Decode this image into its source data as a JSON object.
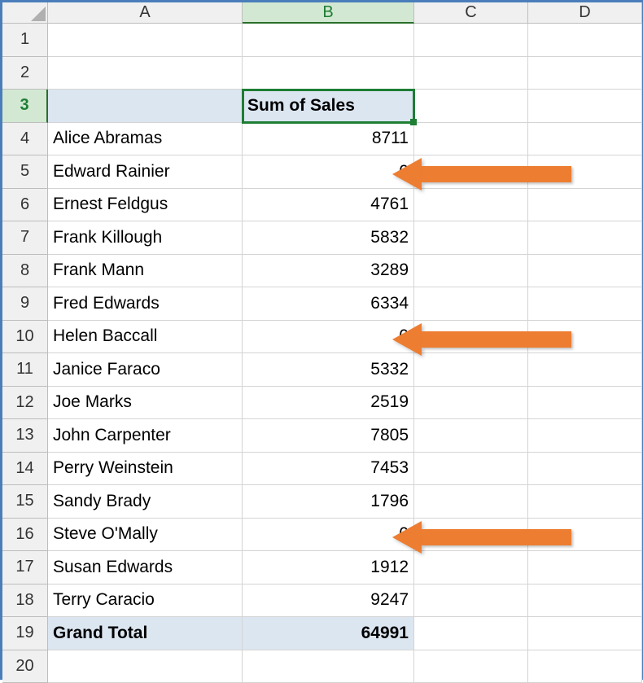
{
  "columns": [
    "A",
    "B",
    "C",
    "D"
  ],
  "active_column": "B",
  "active_row": 3,
  "pivot": {
    "header": {
      "label": "",
      "value_header": "Sum of Sales"
    },
    "rows": [
      {
        "label": "Alice Abramas",
        "value": 8711,
        "arrow": false
      },
      {
        "label": "Edward Rainier",
        "value": 0,
        "arrow": true
      },
      {
        "label": "Ernest Feldgus",
        "value": 4761,
        "arrow": false
      },
      {
        "label": "Frank Killough",
        "value": 5832,
        "arrow": false
      },
      {
        "label": "Frank Mann",
        "value": 3289,
        "arrow": false
      },
      {
        "label": "Fred Edwards",
        "value": 6334,
        "arrow": false
      },
      {
        "label": "Helen Baccall",
        "value": 0,
        "arrow": true
      },
      {
        "label": "Janice Faraco",
        "value": 5332,
        "arrow": false
      },
      {
        "label": "Joe Marks",
        "value": 2519,
        "arrow": false
      },
      {
        "label": "John Carpenter",
        "value": 7805,
        "arrow": false
      },
      {
        "label": "Perry Weinstein",
        "value": 7453,
        "arrow": false
      },
      {
        "label": "Sandy Brady",
        "value": 1796,
        "arrow": false
      },
      {
        "label": "Steve O'Mally",
        "value": 0,
        "arrow": true
      },
      {
        "label": "Susan Edwards",
        "value": 1912,
        "arrow": false
      },
      {
        "label": "Terry Caracio",
        "value": 9247,
        "arrow": false
      }
    ],
    "total": {
      "label": "Grand Total",
      "value": 64991
    }
  },
  "row_numbers": [
    1,
    2,
    3,
    4,
    5,
    6,
    7,
    8,
    9,
    10,
    11,
    12,
    13,
    14,
    15,
    16,
    17,
    18,
    19,
    20
  ]
}
